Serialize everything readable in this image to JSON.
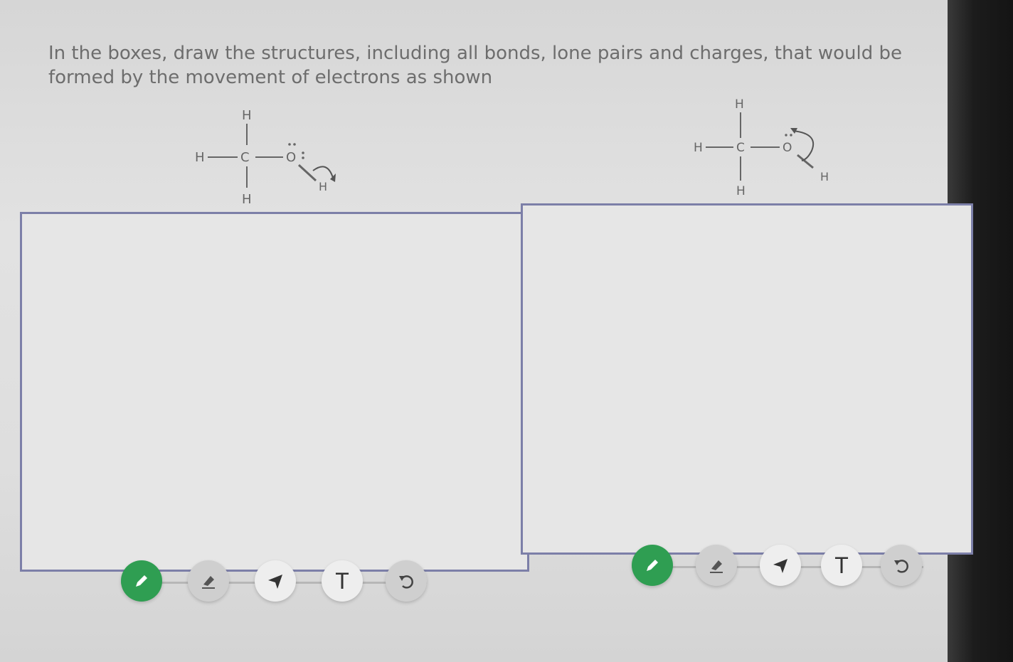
{
  "prompt": "In the boxes, draw the structures, including all bonds, lone pairs and charges, that would be formed by the movement of electrons as shown",
  "molecules": [
    {
      "top_h": "H",
      "left_h": "H",
      "carbon": "C",
      "oxygen": "O",
      "bottom_h": "H",
      "oh_h": "H"
    },
    {
      "top_h": "H",
      "left_h": "H",
      "carbon": "C",
      "oxygen": "O",
      "bottom_h": "H",
      "oh_h": "H"
    }
  ],
  "toolbars": [
    {
      "pen_icon": "pencil-icon",
      "eraser_icon": "eraser-icon",
      "select_icon": "arrow-pointer-icon",
      "text_tool": "T",
      "undo_icon": "undo-icon",
      "active_tool": "pen",
      "accent_color": "#2f9e52"
    },
    {
      "pen_icon": "pencil-icon",
      "eraser_icon": "eraser-icon",
      "select_icon": "arrow-pointer-icon",
      "text_tool": "T",
      "undo_icon": "undo-icon",
      "active_tool": "pen",
      "accent_color": "#2f9e52"
    }
  ],
  "colors": {
    "box_border": "#7c7fa8",
    "prompt_text": "#6d6d6d"
  }
}
